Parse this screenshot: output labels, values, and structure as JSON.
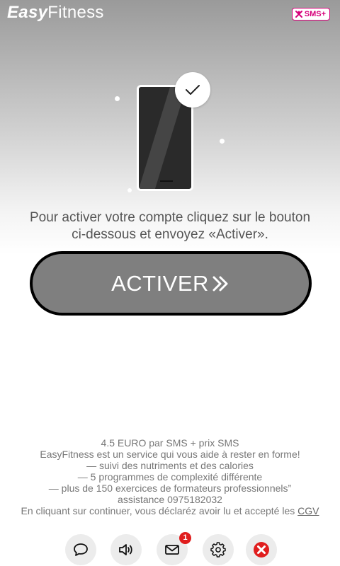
{
  "header": {
    "logo_easy": "Easy",
    "logo_fitness": "Fitness",
    "badge_label": "SMS+"
  },
  "hero": {
    "icon": "phone-check-illustration"
  },
  "instruction": {
    "line1": "Pour activer votre compte cliquez sur le bouton",
    "line2": "ci-dessous et envoyez «Activer»."
  },
  "activate_button": {
    "label": "ACTIVER",
    "icon": "double-chevron-right-icon"
  },
  "info": {
    "price": "4.5 EURO par SMS + prix SMS",
    "tagline": "EasyFitness est un service qui vous aide à rester en forme!",
    "feature1": "— suivi des nutriments et des calories",
    "feature2": "— 5 programmes de complexité différente",
    "feature3": "— plus de 150 exercices de formateurs professionnels”",
    "assistance": "assistance 0975182032",
    "terms_prefix": "En cliquant sur continuer, vous déclaréz avoir lu et accepté les ",
    "terms_link": "CGV"
  },
  "bottom_bar": {
    "chat_icon": "chat-bubble-icon",
    "sound_icon": "speaker-icon",
    "mail_icon": "mail-icon",
    "mail_badge": "1",
    "settings_icon": "gear-icon",
    "close_icon": "close-icon"
  },
  "colors": {
    "accent": "#d6007a",
    "button_fill": "#7f7f7f",
    "close_red": "#e01e1e",
    "badge_red": "#e01e1e"
  }
}
